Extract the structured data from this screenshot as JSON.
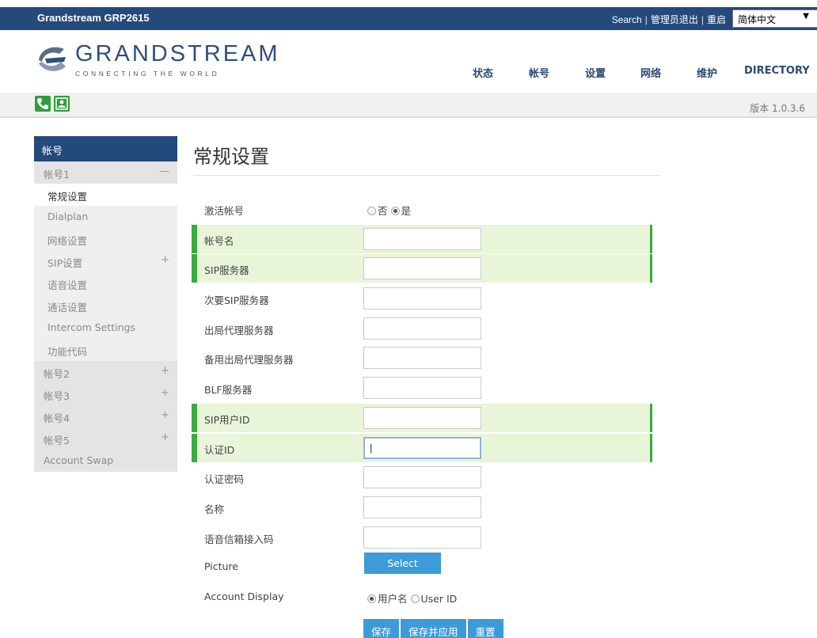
{
  "topbar": {
    "product": "Grandstream GRP2615",
    "search": "Search",
    "logout": "管理员退出",
    "reboot": "重启",
    "language": "简体中文",
    "separator": "|"
  },
  "logo": {
    "brand": "GRANDSTREAM",
    "tagline": "CONNECTING THE WORLD"
  },
  "nav": {
    "items": [
      "状态",
      "帐号",
      "设置",
      "网络",
      "维护",
      "DIRECTORY"
    ]
  },
  "strip": {
    "version": "版本 1.0.3.6"
  },
  "sidebar": {
    "header": "帐号",
    "account1": "帐号1",
    "collapse_symbol": "—",
    "expand_symbol": "+",
    "account1_items": [
      "常规设置",
      "Dialplan",
      "网络设置",
      "SIP设置",
      "语音设置",
      "通话设置",
      "Intercom Settings",
      "功能代码"
    ],
    "accounts": [
      "帐号2",
      "帐号3",
      "帐号4",
      "帐号5"
    ],
    "account_swap": "Account Swap"
  },
  "page": {
    "title": "常规设置"
  },
  "form": {
    "activate": {
      "label": "激活帐号",
      "options": [
        "否",
        "是"
      ],
      "selected": "是"
    },
    "fields": [
      {
        "label": "帐号名",
        "value": "",
        "highlight": true
      },
      {
        "label": "SIP服务器",
        "value": "",
        "highlight": true
      },
      {
        "label": "次要SIP服务器",
        "value": "",
        "highlight": false
      },
      {
        "label": "出局代理服务器",
        "value": "",
        "highlight": false
      },
      {
        "label": "备用出局代理服务器",
        "value": "",
        "highlight": false
      },
      {
        "label": "BLF服务器",
        "value": "",
        "highlight": false
      },
      {
        "label": "SIP用户ID",
        "value": "",
        "highlight": true
      },
      {
        "label": "认证ID",
        "value": "|",
        "highlight": true,
        "focused": true
      },
      {
        "label": "认证密码",
        "value": "",
        "highlight": false
      },
      {
        "label": "名称",
        "value": "",
        "highlight": false
      },
      {
        "label": "语音信箱接入码",
        "value": "",
        "highlight": false
      }
    ],
    "picture": {
      "label": "Picture",
      "button": "Select"
    },
    "display": {
      "label": "Account Display",
      "options": [
        "用户名",
        "User ID"
      ],
      "selected": "用户名"
    }
  },
  "actions": {
    "save": "保存",
    "save_apply": "保存并应用",
    "reset": "重置"
  },
  "colors": {
    "nav_blue": "#24497b",
    "highlight_green": "#e8f5d8",
    "accent_green": "#3aab3e",
    "button_blue": "#3d9bd8"
  }
}
